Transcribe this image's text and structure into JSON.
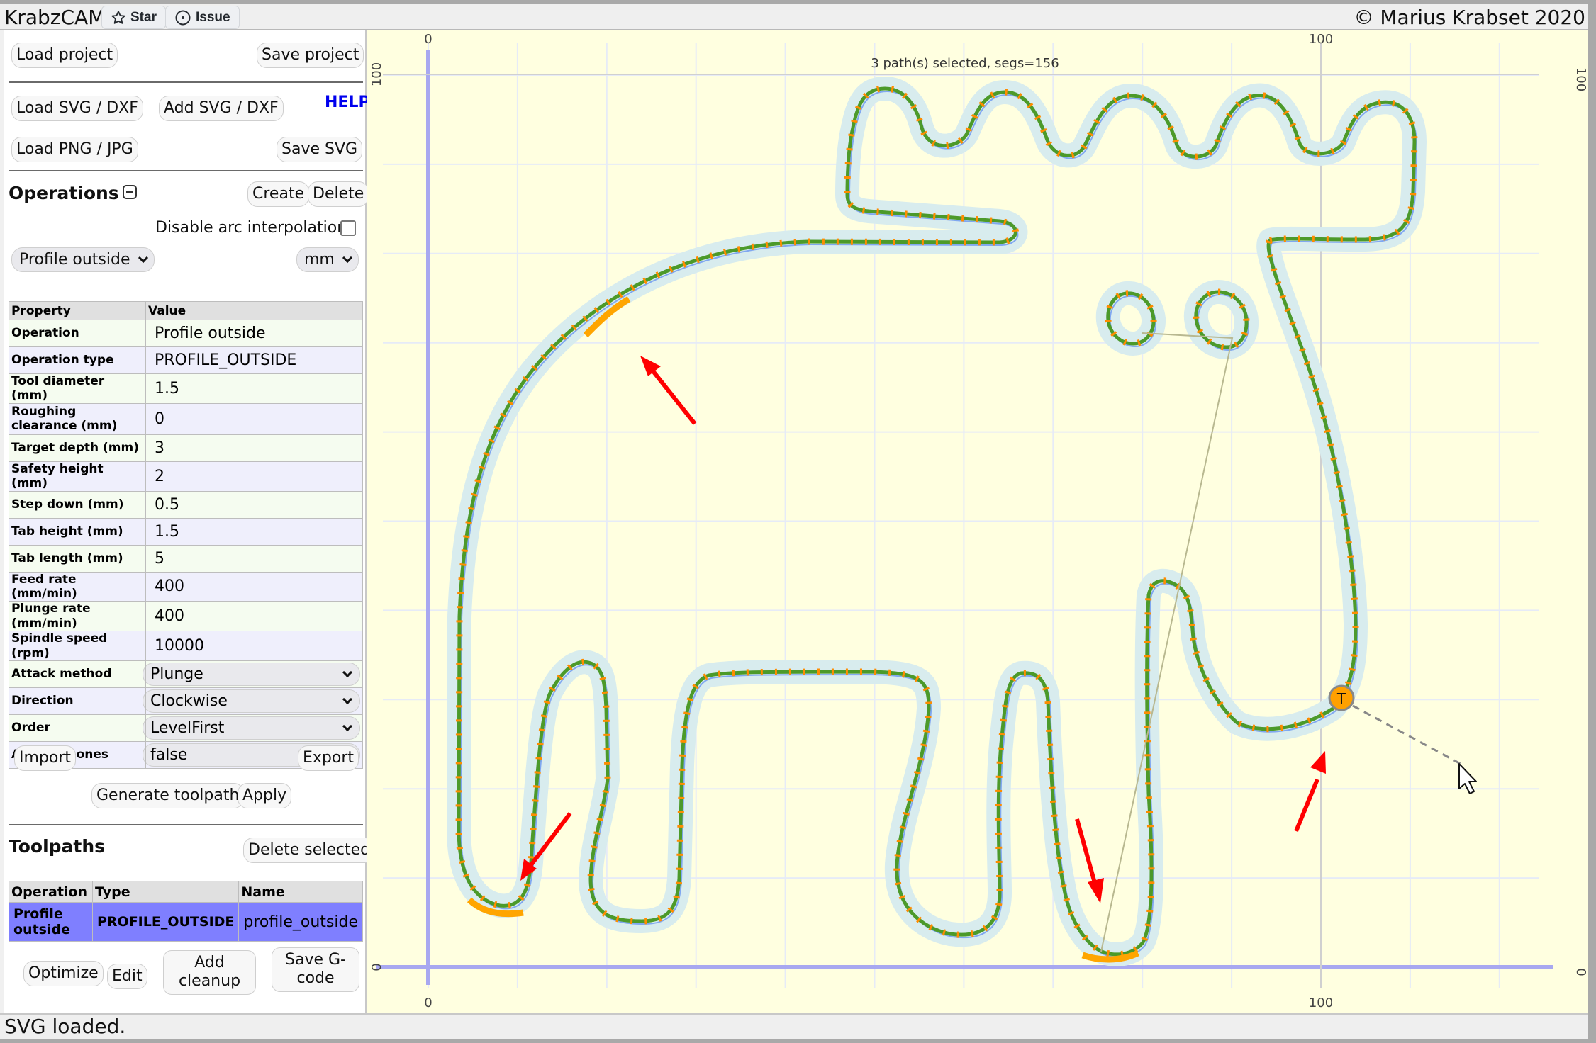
{
  "header": {
    "app_title": "KrabzCAM",
    "star_label": "Star",
    "issue_label": "Issue",
    "copyright": "© Marius Krabset 2020"
  },
  "sidebar": {
    "load_project": "Load project",
    "save_project": "Save project",
    "load_svg_dxf": "Load SVG / DXF",
    "add_svg_dxf": "Add SVG / DXF",
    "help": "HELP",
    "load_png_jpg": "Load PNG / JPG",
    "save_svg": "Save SVG",
    "operations": {
      "title": "Operations",
      "create": "Create",
      "delete": "Delete",
      "disable_arc_label": "Disable arc interpolation",
      "disable_arc_checked": false,
      "operation_select": "Profile outside",
      "unit_select": "mm",
      "table_headers": [
        "Property",
        "Value"
      ],
      "properties": [
        {
          "key": "Operation",
          "value": "Profile outside"
        },
        {
          "key": "Operation type",
          "value": "PROFILE_OUTSIDE"
        },
        {
          "key": "Tool diameter (mm)",
          "value": "1.5"
        },
        {
          "key": "Roughing clearance (mm)",
          "value": "0"
        },
        {
          "key": "Target depth (mm)",
          "value": "3"
        },
        {
          "key": "Safety height (mm)",
          "value": "2"
        },
        {
          "key": "Step down (mm)",
          "value": "0.5"
        },
        {
          "key": "Tab height (mm)",
          "value": "1.5"
        },
        {
          "key": "Tab length (mm)",
          "value": "5"
        },
        {
          "key": "Feed rate (mm/min)",
          "value": "400"
        },
        {
          "key": "Plunge rate (mm/min)",
          "value": "400"
        },
        {
          "key": "Spindle speed (rpm)",
          "value": "10000"
        }
      ],
      "select_properties": [
        {
          "key": "Attack method",
          "value": "Plunge"
        },
        {
          "key": "Direction",
          "value": "Clockwise"
        },
        {
          "key": "Order",
          "value": "LevelFirst"
        },
        {
          "key": "Add dogbones",
          "value": "false"
        }
      ],
      "import": "Import",
      "export": "Export",
      "generate_toolpath": "Generate toolpath",
      "apply": "Apply"
    },
    "toolpaths": {
      "title": "Toolpaths",
      "delete_selected": "Delete selected",
      "headers": [
        "Operation",
        "Type",
        "Name"
      ],
      "rows": [
        {
          "operation": "Profile outside",
          "type": "PROFILE_OUTSIDE",
          "name": "profile_outside"
        }
      ],
      "optimize": "Optimize",
      "edit": "Edit",
      "add_cleanup": "Add cleanup",
      "save_gcode": "Save G-code"
    }
  },
  "canvas": {
    "selection_status": "3 path(s) selected, segs=156",
    "axis_labels": {
      "x_origin": "0",
      "x_100": "100",
      "y_origin": "0",
      "y_100": "100"
    },
    "grid_step_mm": 10,
    "tab_marker_label": "T",
    "colors": {
      "background": "#ffffe0",
      "grid": "#e6ebf7",
      "axis": "#a0a0f0",
      "path": "#4c9a2a",
      "path_points": "#ff8c00",
      "offset_line": "#80a8f0",
      "offset_band": "#d8ecee",
      "tab": "#ffa500",
      "annotation_arrow": "#ff0000"
    }
  },
  "status_bar": {
    "text": "SVG loaded."
  }
}
